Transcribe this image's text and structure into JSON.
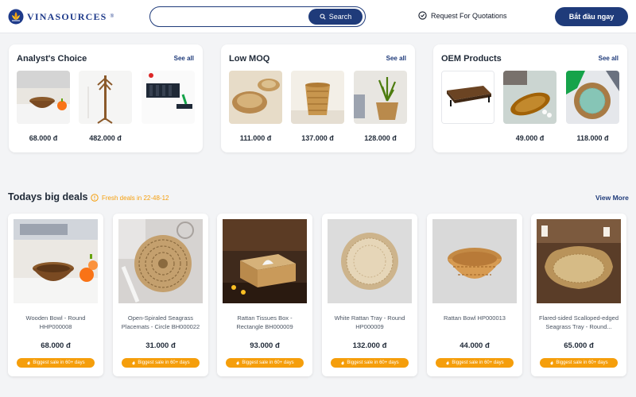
{
  "header": {
    "logo_text": "VINASOURCES",
    "logo_reg": "®",
    "search_placeholder": "",
    "search_label": "Search",
    "rfq_label": "Request For Quotations",
    "cta_label": "Bắt đầu ngay"
  },
  "categories": [
    {
      "title": "Analyst's Choice",
      "see_all": "See all",
      "items": [
        {
          "price": "68.000 đ",
          "image": "wooden-bowl"
        },
        {
          "price": "482.000 đ",
          "image": "coat-rack"
        },
        {
          "price": "",
          "image": "wall-shelf"
        }
      ]
    },
    {
      "title": "Low MOQ",
      "see_all": "See all",
      "items": [
        {
          "price": "111.000 đ",
          "image": "seagrass-tray"
        },
        {
          "price": "137.000 đ",
          "image": "rattan-basket"
        },
        {
          "price": "128.000 đ",
          "image": "planter-basket"
        }
      ]
    },
    {
      "title": "OEM Products",
      "see_all": "See all",
      "items": [
        {
          "price": "",
          "image": "wood-tray-stand"
        },
        {
          "price": "49.000 đ",
          "image": "cutting-board"
        },
        {
          "price": "118.000 đ",
          "image": "woven-round-tray"
        }
      ]
    }
  ],
  "deals": {
    "title": "Todays big deals",
    "fresh_label": "Fresh deals in 22-48-12",
    "view_more": "View More",
    "badge_label": "Biggest sale in 60+ days",
    "items": [
      {
        "name": "Wooden Bowl - Round HHP000008",
        "price": "68.000 đ",
        "image": "wooden-bowl"
      },
      {
        "name": "Open-Spiraled Seagrass Placemats - Circle BH000022",
        "price": "31.000 đ",
        "image": "placemat"
      },
      {
        "name": "Rattan Tissues Box - Rectangle BH000009",
        "price": "93.000 đ",
        "image": "tissue-box"
      },
      {
        "name": "White Rattan Tray - Round HP000009",
        "price": "132.000 đ",
        "image": "white-tray"
      },
      {
        "name": "Rattan Bowl HP000013",
        "price": "44.000 đ",
        "image": "rattan-bowl"
      },
      {
        "name": "Flared-sided Scalloped-edged Seagrass Tray - Round...",
        "price": "65.000 đ",
        "image": "scalloped-tray"
      }
    ]
  },
  "colors": {
    "brand": "#1f3b7a",
    "accent": "#f59e0b",
    "background": "#f3f4f6"
  }
}
